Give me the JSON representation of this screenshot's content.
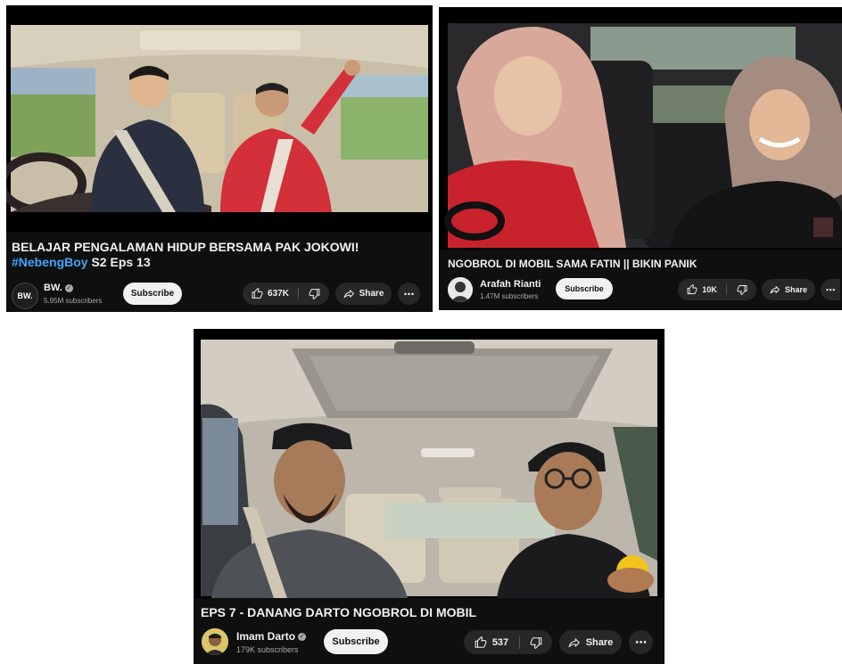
{
  "cards": [
    {
      "title_main": "BELAJAR PENGALAMAN HIDUP BERSAMA PAK JOKOWI! ",
      "title_tag": "#NebengBoy",
      "title_rest": " S2 Eps 13",
      "channel": "BW.",
      "avatar_text": "BW.",
      "subscribers": "5.95M subscribers",
      "subscribe_label": "Subscribe",
      "likes": "637K",
      "share_label": "Share",
      "more_label": "⋯"
    },
    {
      "title_main": "NGOBROL DI MOBIL SAMA FATIN || BIKIN PANIK",
      "channel": "Arafah Rianti",
      "subscribers": "1.47M subscribers",
      "subscribe_label": "Subscribe",
      "likes": "10K",
      "share_label": "Share",
      "more_label": "⋯"
    },
    {
      "title_main": "EPS 7 - DANANG DARTO NGOBROL DI MOBIL",
      "channel": "Imam Darto",
      "subscribers": "179K subscribers",
      "subscribe_label": "Subscribe",
      "likes": "537",
      "share_label": "Share",
      "more_label": "⋯"
    }
  ],
  "icons": {
    "like": "thumbs-up-icon",
    "dislike": "thumbs-down-icon",
    "share": "share-arrow-icon",
    "more": "more-dots-icon",
    "verified": "verified-check-icon"
  },
  "colors": {
    "background": "#0f0f0f",
    "text": "#f1f1f1",
    "secondary_text": "#aaaaaa",
    "hashtag": "#3ea6ff",
    "pill": "#272727",
    "subscribe_bg": "#f1f1f1"
  }
}
